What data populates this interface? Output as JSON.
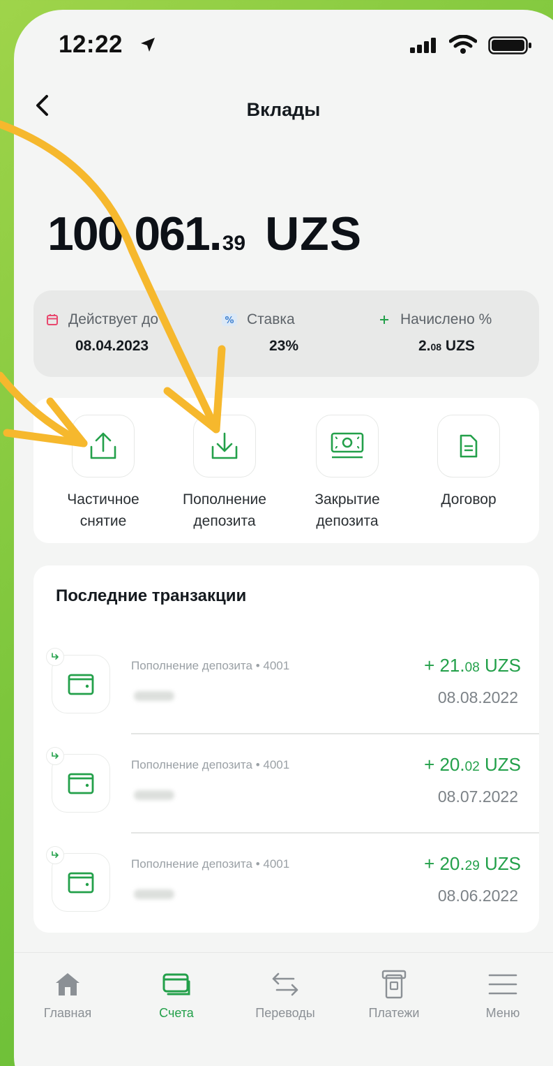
{
  "status_bar": {
    "time": "12:22"
  },
  "nav": {
    "title": "Вклады"
  },
  "balance": {
    "main": "100 061.",
    "decimals": "39",
    "currency": "UZS"
  },
  "info": {
    "valid_until": {
      "label": "Действует до",
      "value": "08.04.2023"
    },
    "rate": {
      "label": "Ставка",
      "value": "23%"
    },
    "accrued": {
      "label": "Начислено %",
      "value_main": "2.",
      "value_dec": "08",
      "value_cur": " UZS"
    }
  },
  "actions": [
    {
      "label_line1": "Частичное",
      "label_line2": "снятие"
    },
    {
      "label_line1": "Пополнение",
      "label_line2": "депозита"
    },
    {
      "label_line1": "Закрытие",
      "label_line2": "депозита"
    },
    {
      "label_line1": "Договор",
      "label_line2": ""
    }
  ],
  "transactions": {
    "title": "Последние транзакции",
    "items": [
      {
        "desc": "Пополнение депозита • 4001",
        "amount_main": "+ 21.",
        "amount_dec": "08",
        "amount_cur": " UZS",
        "date": "08.08.2022"
      },
      {
        "desc": "Пополнение депозита • 4001",
        "amount_main": "+ 20.",
        "amount_dec": "02",
        "amount_cur": " UZS",
        "date": "08.07.2022"
      },
      {
        "desc": "Пополнение депозита • 4001",
        "amount_main": "+ 20.",
        "amount_dec": "29",
        "amount_cur": " UZS",
        "date": "08.06.2022"
      }
    ]
  },
  "tabbar": {
    "home": "Главная",
    "accounts": "Счета",
    "transfers": "Переводы",
    "payments": "Платежи",
    "menu": "Меню"
  },
  "colors": {
    "accent": "#23a04a",
    "annotation_arrow": "#f6b82d",
    "background": "#7cc63c"
  },
  "icons": [
    "location-arrow-icon",
    "signal-icon",
    "wifi-icon",
    "battery-icon",
    "back-chevron-icon",
    "calendar-icon",
    "percent-icon",
    "plus-icon",
    "upload-icon",
    "download-icon",
    "banknote-icon",
    "document-icon",
    "wallet-icon",
    "return-arrow-icon",
    "home-icon",
    "accounts-icon",
    "transfer-arrows-icon",
    "payment-terminal-icon",
    "menu-icon"
  ]
}
